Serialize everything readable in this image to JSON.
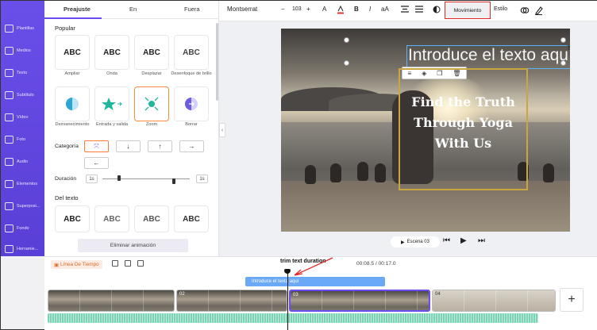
{
  "sidebar": {
    "items": [
      {
        "label": "Plantillas",
        "icon": "template-icon"
      },
      {
        "label": "Medios",
        "icon": "media-icon"
      },
      {
        "label": "Texto",
        "icon": "text-icon"
      },
      {
        "label": "Subtítulo",
        "icon": "subtitle-icon"
      },
      {
        "label": "Vídeo",
        "icon": "video-icon"
      },
      {
        "label": "Foto",
        "icon": "photo-icon"
      },
      {
        "label": "Audio",
        "icon": "audio-icon"
      },
      {
        "label": "Elementos",
        "icon": "elements-icon"
      },
      {
        "label": "Superposi...",
        "icon": "overlay-icon"
      },
      {
        "label": "Fondo",
        "icon": "background-icon"
      },
      {
        "label": "Herramie...",
        "icon": "tools-icon"
      }
    ]
  },
  "panel": {
    "tabs": [
      "Preajuste",
      "En",
      "Fuera"
    ],
    "popular_title": "Popular",
    "popular_row1": [
      {
        "sample": "ABC",
        "caption": "Ampliar"
      },
      {
        "sample": "ABC",
        "caption": "Onda"
      },
      {
        "sample": "ABC",
        "caption": "Desplazar"
      },
      {
        "sample": "ABC",
        "caption": "Desenfoque de brillo"
      }
    ],
    "popular_row2": [
      {
        "caption": "Desvanecimiento"
      },
      {
        "caption": "Entrada y salida"
      },
      {
        "caption": "Zoom"
      },
      {
        "caption": "Borrar"
      }
    ],
    "category_label": "Categoría",
    "directions": [
      "⤧",
      "↓",
      "↑",
      "→",
      "←"
    ],
    "duration_label": "Duración",
    "duration_start": "1s",
    "duration_end": "1s",
    "text_section_title": "Del texto",
    "text_samples": [
      "ABC",
      "ABC",
      "ABC",
      "ABC"
    ],
    "remove_button": "Eliminar animación"
  },
  "toolbar": {
    "font": "Montserrat",
    "minus": "−",
    "size": "103",
    "plus": "+",
    "text_a": "A",
    "bold": "B",
    "italic": "I",
    "case": "aA",
    "movement": "Movimiento",
    "style": "Estilo"
  },
  "canvas": {
    "title_text": "Introduce el texto aquí",
    "headline": [
      "Find the Truth",
      "Through Yoga",
      "With Us"
    ],
    "scene_label": "Escena 03"
  },
  "timeline": {
    "label": "Línea De Tiempo",
    "annotation": "trim text duration",
    "time": "00:08.5 / 00:17.0",
    "text_track": "Introduce el texto aquí",
    "clips": [
      "02",
      "03",
      "04"
    ],
    "add": "+"
  },
  "colors": {
    "accent": "#6c4cf0",
    "sidebar": "#5a3fd6",
    "highlight": "#e02a2a",
    "text_track": "#6aa9f5",
    "audio_wave": "#7ad3b4",
    "gold": "#c9a640"
  }
}
